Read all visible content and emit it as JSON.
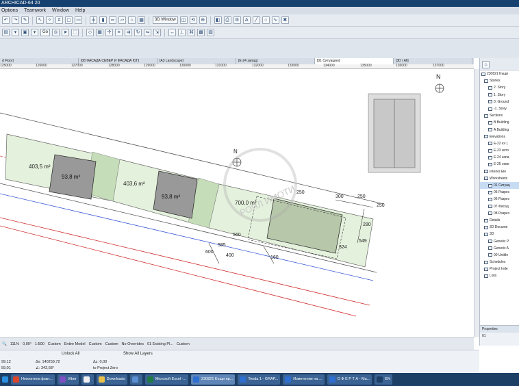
{
  "window": {
    "title": "ARCHICAD-64 20"
  },
  "menu": [
    "Options",
    "Teamwork",
    "Window",
    "Help"
  ],
  "toolbar1": {
    "window_btn": "3D Window"
  },
  "toolbar2": {
    "go_btn": "Go"
  },
  "tabs": [
    {
      "label": "d Floor|"
    },
    {
      "label": "[08 ФАСАДА СЕВЕР И ФАСАДА ЮГ]"
    },
    {
      "label": "[A3 Landscape]"
    },
    {
      "label": "[E-24 запад]"
    },
    {
      "label": "[01 Ситуацию]",
      "active": true
    },
    {
      "label": "[3D / All]"
    }
  ],
  "ruler": [
    "125000",
    "126000",
    "127000",
    "128000",
    "129000",
    "130000",
    "131000",
    "132000",
    "133000",
    "134000",
    "135000",
    "136000",
    "137000"
  ],
  "drawing": {
    "north_label": "N",
    "plots": [
      "403,5 m²",
      "403,6 m²",
      "700,0 m²"
    ],
    "houses": [
      "93,8 m²",
      "93,8 m²"
    ],
    "dims": [
      "300",
      "250",
      "250",
      "280",
      "549",
      "324",
      "585",
      "400",
      "560",
      "600",
      "160",
      "250"
    ],
    "watermark": "РОЯЛ ИМОТИ"
  },
  "navigator": {
    "project": "230821 Къщи",
    "items": [
      {
        "label": "Stories",
        "level": 1
      },
      {
        "label": "2. Story",
        "level": 2
      },
      {
        "label": "1. Story",
        "level": 2
      },
      {
        "label": "0. Ground",
        "level": 2
      },
      {
        "label": "-1. Story",
        "level": 2
      },
      {
        "label": "Sections",
        "level": 1
      },
      {
        "label": "B Building",
        "level": 2
      },
      {
        "label": "A Building",
        "level": 2
      },
      {
        "label": "Elevations",
        "level": 1
      },
      {
        "label": "E-22 юг (",
        "level": 2
      },
      {
        "label": "E-23 изто",
        "level": 2
      },
      {
        "label": "E-24 запа",
        "level": 2
      },
      {
        "label": "E-25 севе",
        "level": 2
      },
      {
        "label": "Interior Ele",
        "level": 1
      },
      {
        "label": "Worksheets",
        "level": 1
      },
      {
        "label": "01 Ситуац",
        "level": 2,
        "selected": true
      },
      {
        "label": "05 Разрез",
        "level": 2
      },
      {
        "label": "06 Разрез",
        "level": 2
      },
      {
        "label": "07 Фасад",
        "level": 2
      },
      {
        "label": "08 Разрез",
        "level": 2
      },
      {
        "label": "Details",
        "level": 1
      },
      {
        "label": "3D Docume",
        "level": 1
      },
      {
        "label": "3D",
        "level": 1
      },
      {
        "label": "Generic P",
        "level": 2
      },
      {
        "label": "Generic A",
        "level": 2
      },
      {
        "label": "00 Untitle",
        "level": 2
      },
      {
        "label": "Schedules",
        "level": 1
      },
      {
        "label": "Project Inde",
        "level": 1
      },
      {
        "label": "Lists",
        "level": 1
      }
    ]
  },
  "properties": {
    "title": "Properties",
    "value": "01"
  },
  "status": {
    "zoom": "111%",
    "angle": "0,00°",
    "scale": "1:500",
    "pen_set": "Custom",
    "model_view": "Entire Model",
    "custom2": "Custom",
    "custom3": "Custom",
    "overrides": "No Overrides",
    "existing": "01 Existing Pl...",
    "custom4": "Custom"
  },
  "infobar": {
    "unlock": "Unlock All",
    "show_layers": "Show All Layers",
    "coord_x": "99,12",
    "coord_y": "59,01",
    "delta_x": "Δx: 140259,72",
    "delta_y": "∠: 342,68°",
    "dz_label": "Δz: 0,00",
    "dz_ref": "to Project Zero"
  },
  "taskbar": [
    {
      "label": "Неплатена факт...",
      "color": "#d9462b"
    },
    {
      "label": "Viber",
      "color": "#7d4fc2"
    },
    {
      "label": "",
      "color": "#f0f0f0"
    },
    {
      "label": "Downloads",
      "color": "#e8c14a"
    },
    {
      "label": "",
      "color": "#5b8fd1"
    },
    {
      "label": "Microsoft Excel -...",
      "color": "#1f7a44"
    },
    {
      "label": "230821 Къщи пр...",
      "color": "#2f6fd1",
      "active": true
    },
    {
      "label": "Teoda 1 - GRAP...",
      "color": "#2f6fd1"
    },
    {
      "label": "Изменение на ...",
      "color": "#2f6fd1"
    },
    {
      "label": "О Ф Е Р Т А - Ма...",
      "color": "#2f6fd1"
    },
    {
      "label": "EN",
      "color": "#1d3f66"
    }
  ]
}
